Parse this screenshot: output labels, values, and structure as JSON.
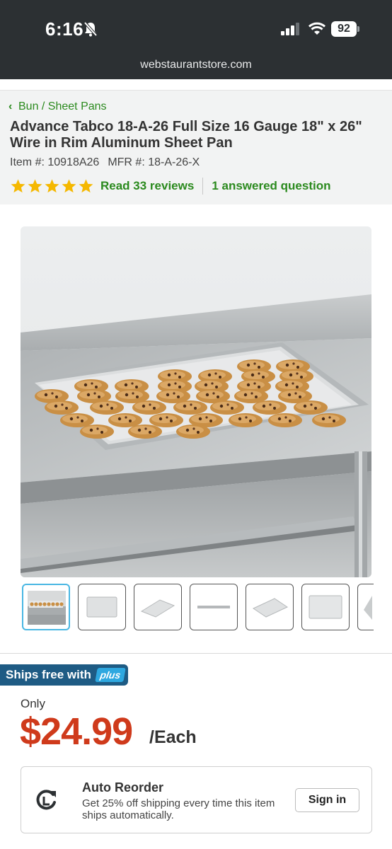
{
  "status": {
    "time": "6:16",
    "battery": "92"
  },
  "url": {
    "domain": "webstaurantstore.com"
  },
  "product": {
    "breadcrumb": "Bun / Sheet Pans",
    "title": "Advance Tabco 18-A-26 Full Size 16 Gauge 18\" x 26\" Wire in Rim Aluminum Sheet Pan",
    "item_number": "Item #: 10918A26",
    "mfr_number": "MFR #: 18-A-26-X",
    "rating": 5,
    "reviews_link": "Read 33 reviews",
    "answered_link": "1 answered question"
  },
  "gallery": {
    "thumbnail_count": 7,
    "selected_index": 0
  },
  "shipping": {
    "ships_free_label": "Ships free with",
    "plus_badge": "plus"
  },
  "pricing": {
    "only_label": "Only",
    "price": "$24.99",
    "unit": "/Each"
  },
  "auto_reorder": {
    "title": "Auto Reorder",
    "description": "Get 25% off shipping every time this item ships automatically.",
    "sign_in_label": "Sign in"
  },
  "colors": {
    "accent_green": "#2b8a1e",
    "price_red": "#cf3a1b",
    "ships_blue": "#1e5b84",
    "plus_blue": "#2ea8e0",
    "star_yellow": "#f5b800"
  }
}
